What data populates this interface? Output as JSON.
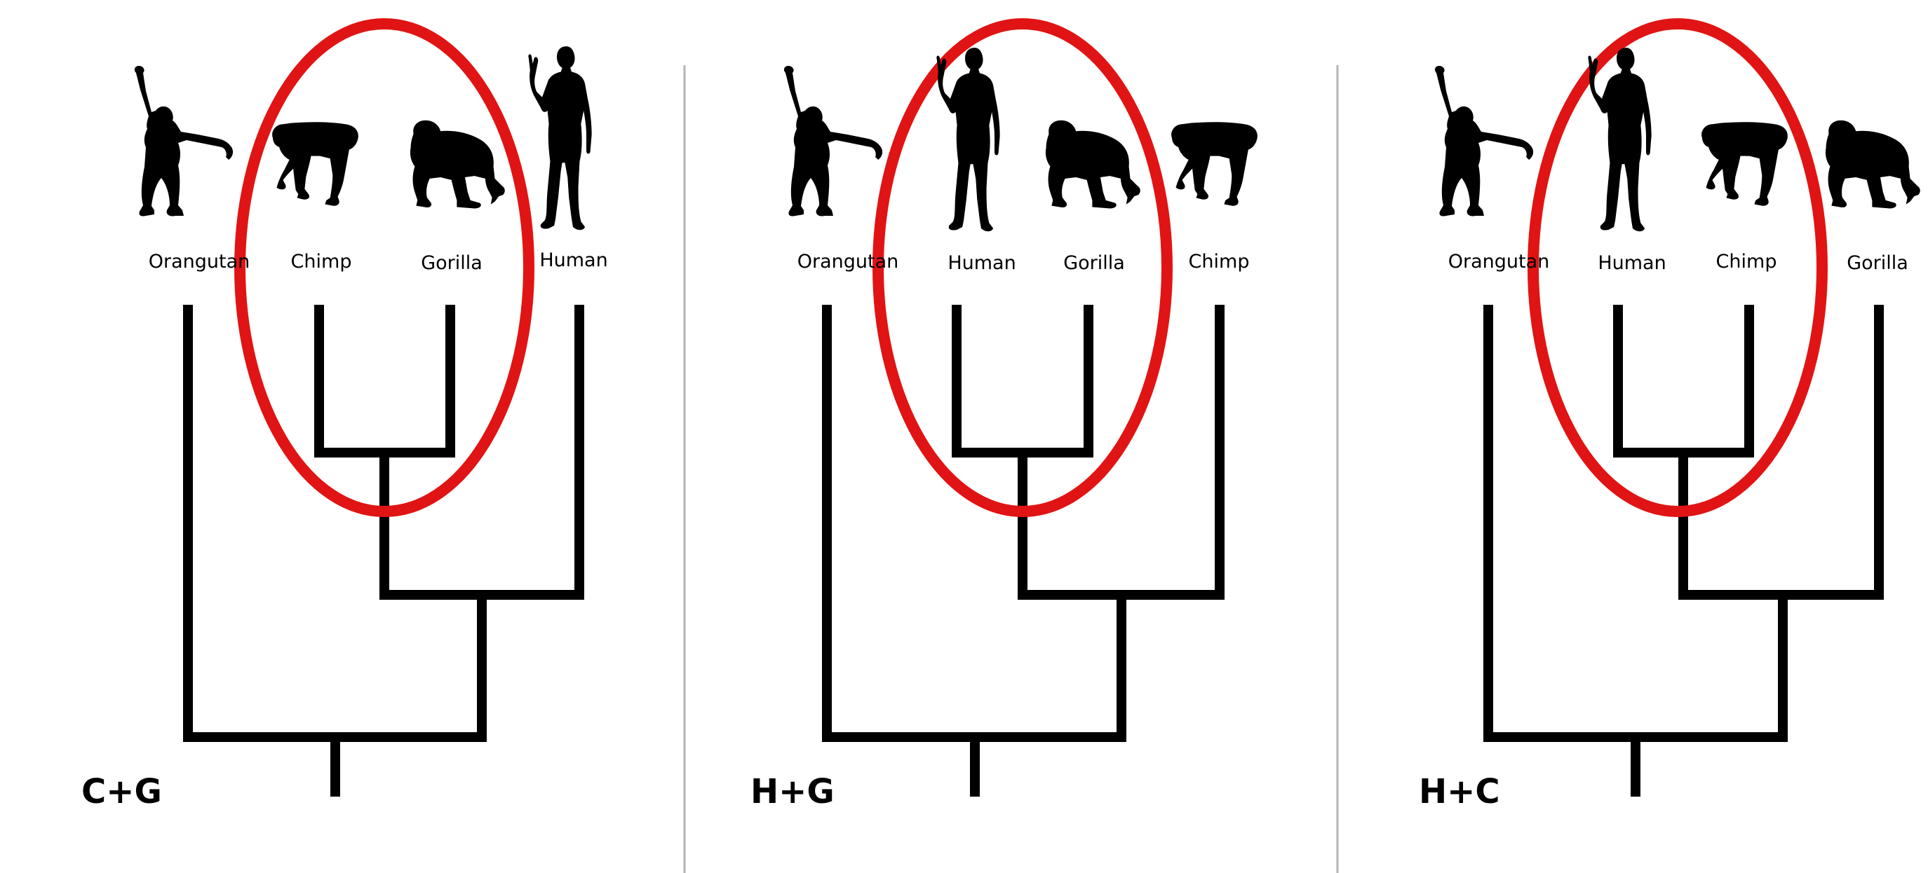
{
  "colors": {
    "branch": "#000000",
    "highlight_ring": "#e01414",
    "divider": "#b4b4b4",
    "background": "#ffffff"
  },
  "panels": [
    {
      "label": "C+G",
      "taxa": [
        {
          "name": "Orangutan",
          "icon": "orangutan-silhouette-icon"
        },
        {
          "name": "Chimp",
          "icon": "chimp-silhouette-icon"
        },
        {
          "name": "Gorilla",
          "icon": "gorilla-silhouette-icon"
        },
        {
          "name": "Human",
          "icon": "human-silhouette-icon"
        }
      ],
      "highlighted_clade": [
        "Chimp",
        "Gorilla"
      ]
    },
    {
      "label": "H+G",
      "taxa": [
        {
          "name": "Orangutan",
          "icon": "orangutan-silhouette-icon"
        },
        {
          "name": "Human",
          "icon": "human-silhouette-icon"
        },
        {
          "name": "Gorilla",
          "icon": "gorilla-silhouette-icon"
        },
        {
          "name": "Chimp",
          "icon": "chimp-silhouette-icon"
        }
      ],
      "highlighted_clade": [
        "Human",
        "Gorilla"
      ]
    },
    {
      "label": "H+C",
      "taxa": [
        {
          "name": "Orangutan",
          "icon": "orangutan-silhouette-icon"
        },
        {
          "name": "Human",
          "icon": "human-silhouette-icon"
        },
        {
          "name": "Chimp",
          "icon": "chimp-silhouette-icon"
        },
        {
          "name": "Gorilla",
          "icon": "gorilla-silhouette-icon"
        }
      ],
      "highlighted_clade": [
        "Human",
        "Chimp"
      ]
    }
  ]
}
